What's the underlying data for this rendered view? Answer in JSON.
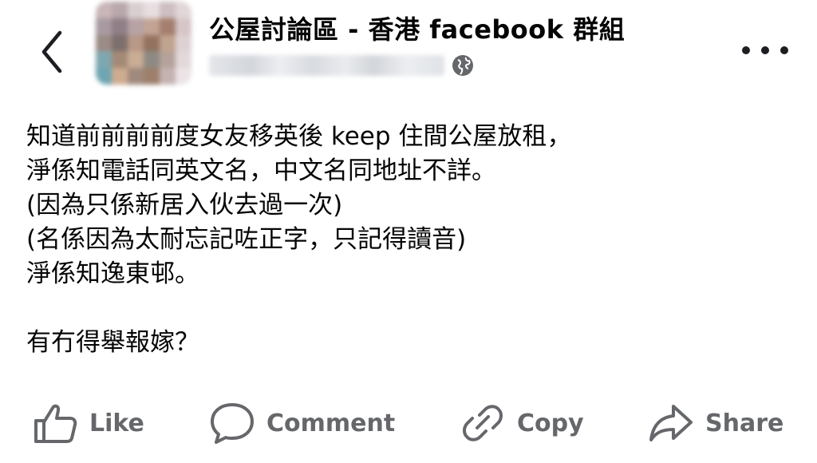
{
  "header": {
    "group_title": "公屋討論區 - 香港 facebook 群組",
    "back_icon": "chevron-left-icon",
    "more_icon": "more-horizontal-icon",
    "privacy_icon": "globe-icon"
  },
  "post": {
    "lines": [
      "知道前前前前度女友移英後 keep 住間公屋放租，",
      "淨係知電話同英文名，中文名同地址不詳。",
      "(因為只係新居入伙去過一次)",
      "(名係因為太耐忘記咗正字，只記得讀音)",
      "淨係知逸東邨。",
      "",
      "有冇得舉報嫁？"
    ]
  },
  "actions": {
    "like_label": "Like",
    "comment_label": "Comment",
    "copy_label": "Copy",
    "share_label": "Share"
  },
  "colors": {
    "text": "#050505",
    "secondary": "#65676b",
    "background": "#ffffff"
  }
}
